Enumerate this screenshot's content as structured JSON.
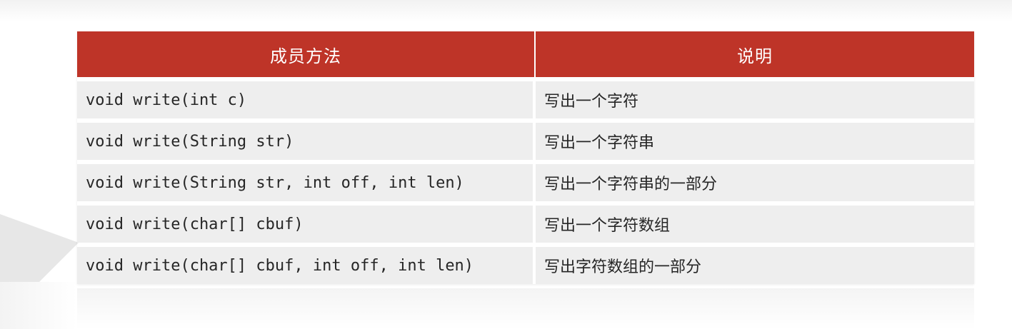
{
  "table": {
    "headers": [
      "成员方法",
      "说明"
    ],
    "rows": [
      {
        "method": "void write(int c)",
        "desc": "写出一个字符"
      },
      {
        "method": "void write(String str)",
        "desc": "写出一个字符串"
      },
      {
        "method": "void write(String str, int off, int len)",
        "desc": "写出一个字符串的一部分"
      },
      {
        "method": "void write(char[] cbuf)",
        "desc": "写出一个字符数组"
      },
      {
        "method": "void write(char[] cbuf, int off, int len)",
        "desc": "写出字符数组的一部分"
      }
    ]
  },
  "colors": {
    "header_bg": "#be3428",
    "row_bg": "#eeeeee"
  }
}
